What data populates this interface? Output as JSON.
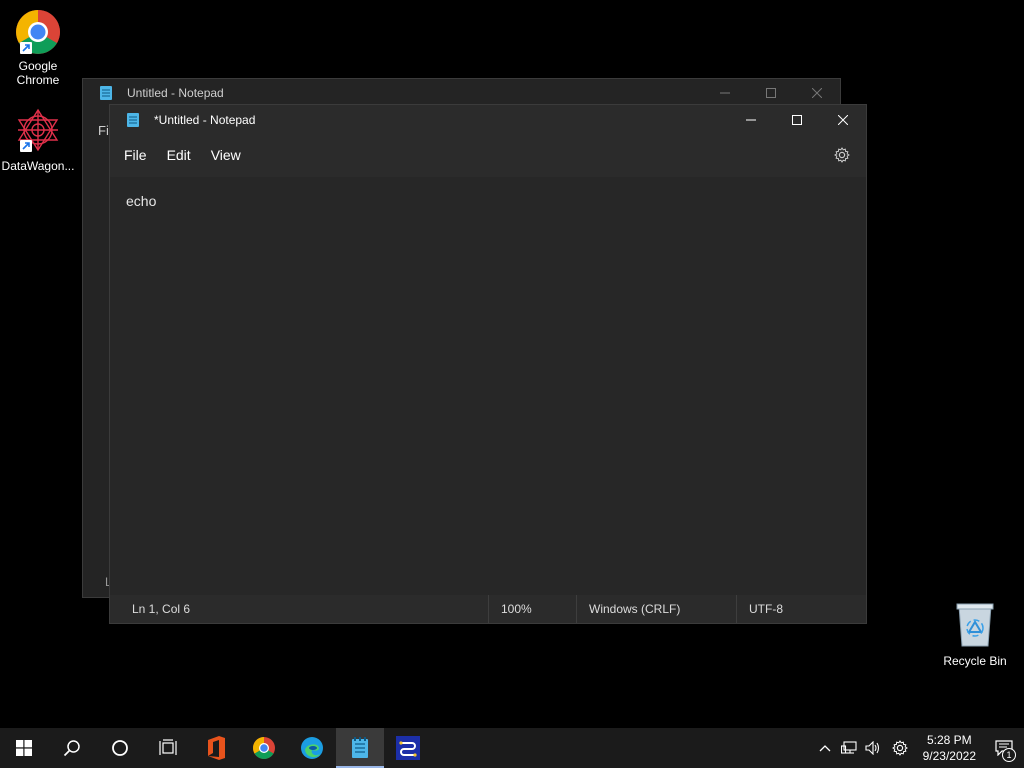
{
  "desktop": {
    "icons": [
      {
        "label": "Google Chrome",
        "icon": "chrome-icon"
      },
      {
        "label": "DataWagon...",
        "icon": "datawagon-icon"
      },
      {
        "label": "Recycle Bin",
        "icon": "recycle-bin-icon"
      }
    ]
  },
  "back_window": {
    "title": "Untitled - Notepad",
    "menu_partial": "Fi",
    "status_partial": "L"
  },
  "front_window": {
    "title": "*Untitled - Notepad",
    "menu": [
      "File",
      "Edit",
      "View"
    ],
    "content": "echo",
    "status": {
      "position": "Ln 1, Col 6",
      "zoom": "100%",
      "line_ending": "Windows (CRLF)",
      "encoding": "UTF-8"
    }
  },
  "taskbar": {
    "apps": [
      "start-icon",
      "search-icon",
      "cortana-icon",
      "task-view-icon",
      "office-icon",
      "chrome-icon",
      "edge-icon",
      "notepad-icon",
      "app-icon"
    ],
    "clock": {
      "time": "5:28 PM",
      "date": "9/23/2022"
    },
    "notification_count": "1"
  },
  "colors": {
    "accent": "#9ab7e8",
    "window_bg": "#2b2b2b",
    "editor_bg": "#272727"
  }
}
